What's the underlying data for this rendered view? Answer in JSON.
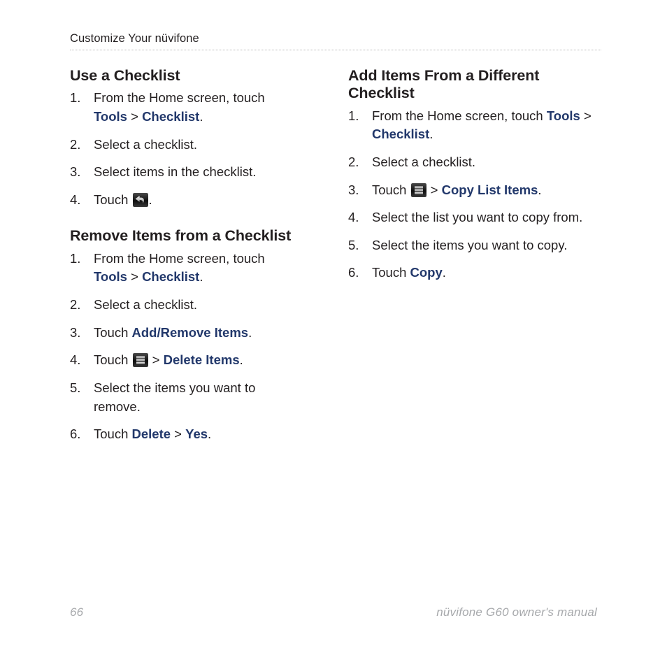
{
  "header": {
    "running_head": "Customize Your nüvifone"
  },
  "left_column": {
    "sections": [
      {
        "heading": "Use a Checklist",
        "steps": [
          {
            "num": "1.",
            "parts": [
              {
                "t": "text",
                "v": "From the Home screen, touch "
              },
              {
                "t": "bold",
                "v": "Tools"
              },
              {
                "t": "text",
                "v": " > "
              },
              {
                "t": "bold",
                "v": "Checklist"
              },
              {
                "t": "text",
                "v": "."
              }
            ]
          },
          {
            "num": "2.",
            "parts": [
              {
                "t": "text",
                "v": "Select a checklist."
              }
            ]
          },
          {
            "num": "3.",
            "parts": [
              {
                "t": "text",
                "v": "Select items in the checklist."
              }
            ]
          },
          {
            "num": "4.",
            "parts": [
              {
                "t": "text",
                "v": "Touch "
              },
              {
                "t": "icon",
                "v": "back-arrow-icon"
              },
              {
                "t": "text",
                "v": "."
              }
            ]
          }
        ]
      },
      {
        "heading": "Remove Items from a Checklist",
        "steps": [
          {
            "num": "1.",
            "parts": [
              {
                "t": "text",
                "v": "From the Home screen, touch "
              },
              {
                "t": "bold",
                "v": "Tools"
              },
              {
                "t": "text",
                "v": " > "
              },
              {
                "t": "bold",
                "v": "Checklist"
              },
              {
                "t": "text",
                "v": "."
              }
            ]
          },
          {
            "num": "2.",
            "parts": [
              {
                "t": "text",
                "v": "Select a checklist."
              }
            ]
          },
          {
            "num": "3.",
            "parts": [
              {
                "t": "text",
                "v": "Touch "
              },
              {
                "t": "bold",
                "v": "Add/Remove Items"
              },
              {
                "t": "text",
                "v": "."
              }
            ]
          },
          {
            "num": "4.",
            "parts": [
              {
                "t": "text",
                "v": "Touch "
              },
              {
                "t": "icon",
                "v": "menu-icon"
              },
              {
                "t": "text",
                "v": " > "
              },
              {
                "t": "bold",
                "v": "Delete Items"
              },
              {
                "t": "text",
                "v": "."
              }
            ]
          },
          {
            "num": "5.",
            "parts": [
              {
                "t": "text",
                "v": "Select the items you want to remove."
              }
            ]
          },
          {
            "num": "6.",
            "parts": [
              {
                "t": "text",
                "v": "Touch "
              },
              {
                "t": "bold",
                "v": "Delete"
              },
              {
                "t": "text",
                "v": " > "
              },
              {
                "t": "bold",
                "v": "Yes"
              },
              {
                "t": "text",
                "v": "."
              }
            ]
          }
        ]
      }
    ]
  },
  "right_column": {
    "sections": [
      {
        "heading": "Add Items From a Different Checklist",
        "steps": [
          {
            "num": "1.",
            "parts": [
              {
                "t": "text",
                "v": "From the Home screen, touch "
              },
              {
                "t": "bold",
                "v": "Tools"
              },
              {
                "t": "text",
                "v": " > "
              },
              {
                "t": "bold",
                "v": "Checklist"
              },
              {
                "t": "text",
                "v": "."
              }
            ]
          },
          {
            "num": "2.",
            "parts": [
              {
                "t": "text",
                "v": "Select a checklist."
              }
            ]
          },
          {
            "num": "3.",
            "parts": [
              {
                "t": "text",
                "v": "Touch "
              },
              {
                "t": "icon",
                "v": "menu-icon"
              },
              {
                "t": "text",
                "v": " > "
              },
              {
                "t": "bold",
                "v": "Copy List Items"
              },
              {
                "t": "text",
                "v": "."
              }
            ]
          },
          {
            "num": "4.",
            "parts": [
              {
                "t": "text",
                "v": "Select the list you want to copy from."
              }
            ]
          },
          {
            "num": "5.",
            "parts": [
              {
                "t": "text",
                "v": "Select the items you want to copy."
              }
            ]
          },
          {
            "num": "6.",
            "parts": [
              {
                "t": "text",
                "v": "Touch "
              },
              {
                "t": "bold",
                "v": "Copy"
              },
              {
                "t": "text",
                "v": "."
              }
            ]
          }
        ]
      }
    ]
  },
  "footer": {
    "page_number": "66",
    "manual_title": "nüvifone G60 owner's manual"
  },
  "colors": {
    "link_blue": "#22386b",
    "body_text": "#231f20",
    "footer_gray": "#a6a8ab",
    "rule_gray": "#b9b9b9",
    "icon_dark": "#1c1c1c"
  }
}
